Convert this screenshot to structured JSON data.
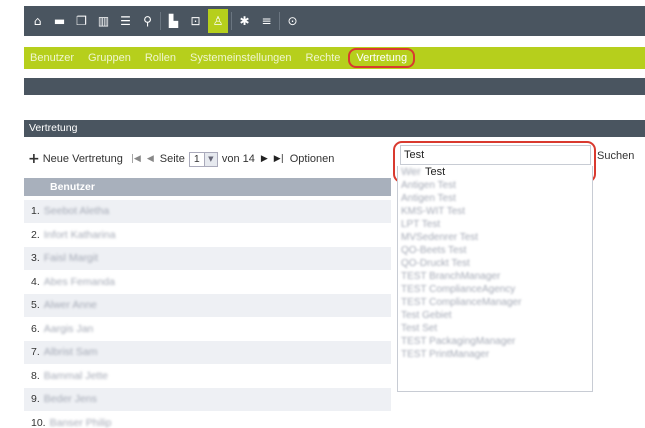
{
  "toolbar": {
    "icons": [
      "home-icon",
      "folder-icon",
      "document-icon",
      "books-icon",
      "list-icon",
      "search-icon",
      "chart-icon",
      "clipboard-icon",
      "user-icon",
      "gear-icon",
      "server-icon",
      "help-icon"
    ],
    "glyphs": [
      "⌂",
      "▬",
      "❐",
      "▥",
      "☰",
      "⚲",
      "▙",
      "⊡",
      "♙",
      "✱",
      "≡",
      "⊙"
    ],
    "active_index": 8
  },
  "menu": {
    "items": [
      "Benutzer",
      "Gruppen",
      "Rollen",
      "Systemeinstellungen",
      "Rechte",
      "Vertretung"
    ],
    "selected": "Vertretung"
  },
  "panel": {
    "title": "Vertretung"
  },
  "pager": {
    "new_label": "Neue Vertretung",
    "page_label": "Seite",
    "page_value": "1",
    "of_label": "von 14",
    "options_label": "Optionen"
  },
  "search": {
    "value": "Test",
    "button_label": "Suchen"
  },
  "table": {
    "header": "Benutzer",
    "rows": [
      {
        "num": "1.",
        "name": "Seebot Aletha"
      },
      {
        "num": "2.",
        "name": "Infort Katharina"
      },
      {
        "num": "3.",
        "name": "Faisl Margit"
      },
      {
        "num": "4.",
        "name": "Abes Femanda"
      },
      {
        "num": "5.",
        "name": "Alwer Anne"
      },
      {
        "num": "6.",
        "name": "Aargis Jan"
      },
      {
        "num": "7.",
        "name": "Albrist Sam"
      },
      {
        "num": "8.",
        "name": "Bammal Jette"
      },
      {
        "num": "9.",
        "name": "Beder Jens"
      },
      {
        "num": "10.",
        "name": "Banser Philip"
      }
    ]
  },
  "dropdown": {
    "first_prefix": "Wer",
    "first_text": "Test",
    "items": [
      "Antigen Test",
      "Antigen Test",
      "KMS-WIT Test",
      "LPT Test",
      "MVSedenrer Test",
      "QO-Beets Test",
      "QO-Druckt Test",
      "TEST BranchManager",
      "TEST ComplianceAgency",
      "TEST ComplianceManager",
      "Test Gebiet",
      "Test Set",
      "TEST PackagingManager",
      "TEST PrintManager"
    ]
  }
}
